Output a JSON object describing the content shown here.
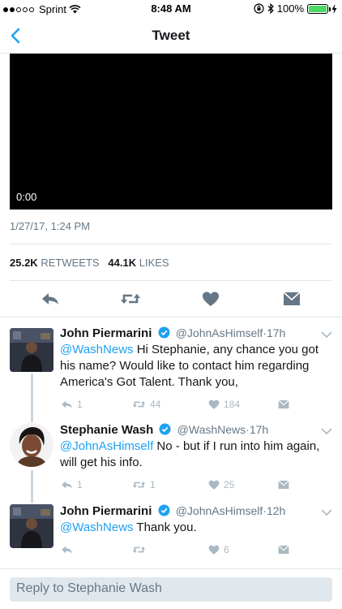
{
  "status_bar": {
    "carrier": "Sprint",
    "time": "8:48 AM",
    "battery": "100%",
    "battery_level": 1.0
  },
  "nav": {
    "title": "Tweet"
  },
  "video": {
    "time": "0:00"
  },
  "tweet": {
    "date": "1/27/17, 1:24 PM",
    "retweets_count": "25.2K",
    "retweets_label": "RETWEETS",
    "likes_count": "44.1K",
    "likes_label": "LIKES"
  },
  "replies": [
    {
      "name": "John Piermarini",
      "handle": "@JohnAsHimself",
      "time": "17h",
      "mention": "@WashNews",
      "text": " Hi Stephanie, any chance you got his name? Would like to contact him regarding America's Got Talent. Thank you,",
      "reply_count": "1",
      "retweet_count": "44",
      "like_count": "184"
    },
    {
      "name": "Stephanie Wash",
      "handle": "@WashNews",
      "time": "17h",
      "mention": "@JohnAsHimself",
      "text": " No - but if I run into him again, will get his info.",
      "reply_count": "1",
      "retweet_count": "1",
      "like_count": "25"
    },
    {
      "name": "John Piermarini",
      "handle": "@JohnAsHimself",
      "time": "12h",
      "mention": "@WashNews",
      "text": " Thank you.",
      "reply_count": "",
      "retweet_count": "",
      "like_count": "6"
    }
  ],
  "composer": {
    "placeholder": "Reply to Stephanie Wash"
  },
  "colors": {
    "accent": "#1da1f2",
    "secondary_text": "#657786",
    "icon_gray": "#657786",
    "muted_icon": "#aab8c2"
  }
}
